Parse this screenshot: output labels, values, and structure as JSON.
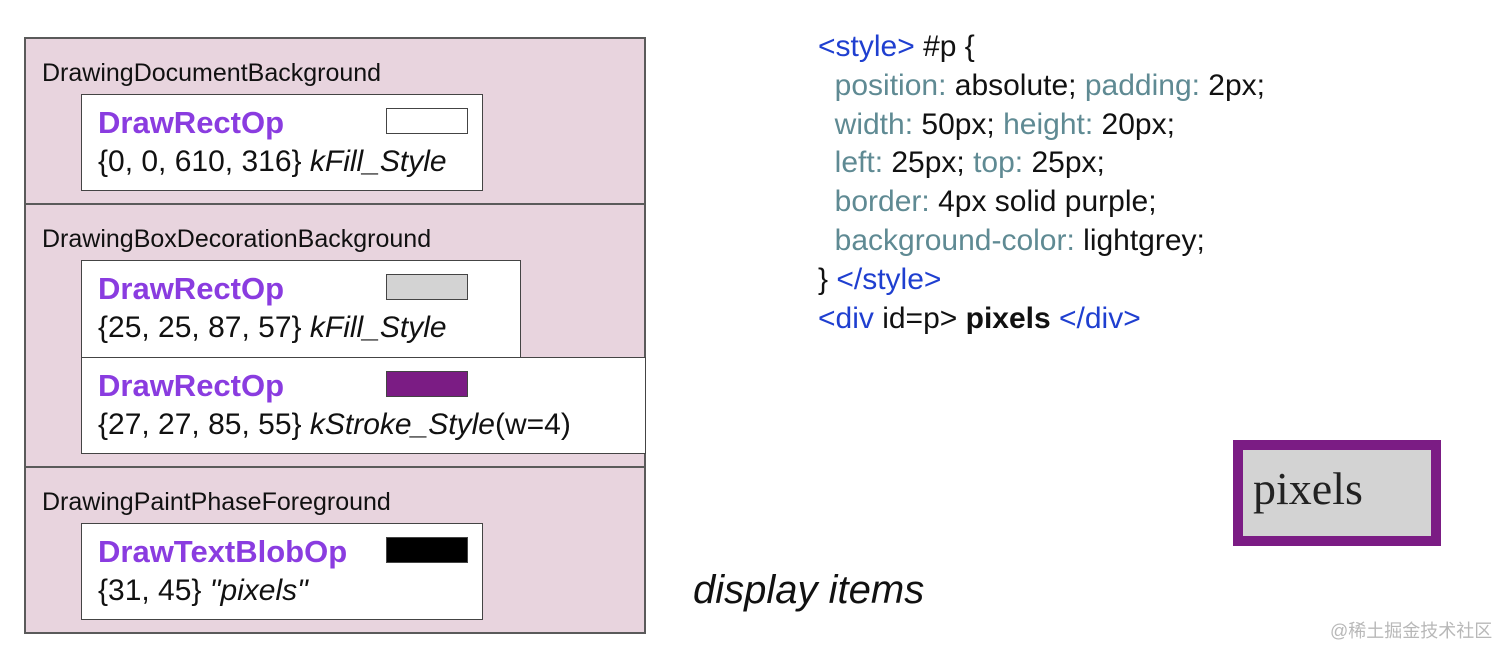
{
  "groups": [
    {
      "title": "DrawingDocumentBackground",
      "ops": [
        {
          "name": "DrawRectOp",
          "args": "{0, 0, 610, 316}",
          "style": "kFill_Style",
          "suffix": "",
          "swatch": "#ffffff"
        }
      ]
    },
    {
      "title": "DrawingBoxDecorationBackground",
      "ops": [
        {
          "name": "DrawRectOp",
          "args": "{25, 25, 87, 57}",
          "style": "kFill_Style",
          "suffix": "",
          "swatch": "#d3d3d3"
        },
        {
          "name": "DrawRectOp",
          "args": "{27, 27, 85, 55}",
          "style": "kStroke_Style",
          "suffix": "(w=4)",
          "swatch": "#7b1c84"
        }
      ]
    },
    {
      "title": "DrawingPaintPhaseForeground",
      "ops": [
        {
          "name": "DrawTextBlobOp",
          "args": "{31, 45}",
          "style": "\"pixels\"",
          "suffix": "",
          "swatch": "#000000"
        }
      ]
    }
  ],
  "code": {
    "style_open": "<style>",
    "selector": " #p {",
    "lines": [
      {
        "p1": "position:",
        "v1": " absolute; ",
        "p2": "padding:",
        "v2": " 2px;"
      },
      {
        "p1": "width:",
        "v1": " 50px; ",
        "p2": "height:",
        "v2": " 20px;"
      },
      {
        "p1": "left:",
        "v1": " 25px; ",
        "p2": "top:",
        "v2": " 25px;"
      },
      {
        "p1": "border:",
        "v1": " 4px solid purple;",
        "p2": "",
        "v2": ""
      },
      {
        "p1": "background-color:",
        "v1": " lightgrey;",
        "p2": "",
        "v2": ""
      }
    ],
    "close_brace": "} ",
    "style_close": "</style>",
    "div_open": "<div",
    "div_attr": " id=p> ",
    "div_text": "pixels",
    "div_close": " </div>"
  },
  "caption": "display items",
  "rendered_text": "pixels",
  "rendered_colors": {
    "fill": "#d3d3d3",
    "border": "#7b1c84"
  },
  "watermark": "@稀土掘金技术社区"
}
